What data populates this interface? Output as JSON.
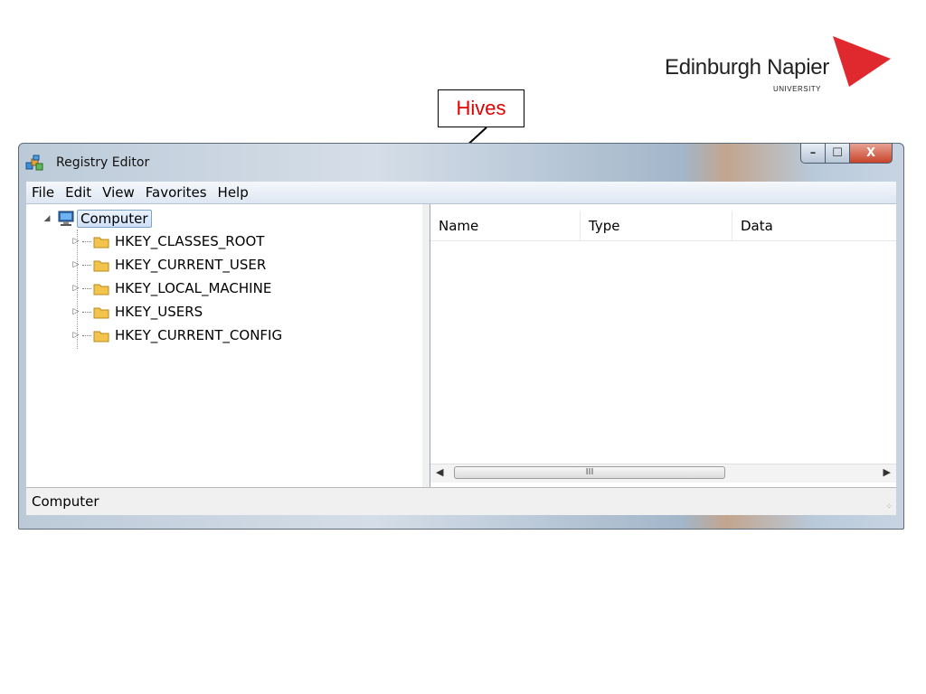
{
  "logo": {
    "name": "Edinburgh Napier",
    "sub": "UNIVERSITY",
    "accent": "#e0292f"
  },
  "callout": {
    "text": "Hives",
    "color": "#e00000"
  },
  "window": {
    "title": "Registry Editor",
    "buttons": {
      "minimize": "–",
      "maximize": "☐",
      "close": "X"
    }
  },
  "menu": [
    "File",
    "Edit",
    "View",
    "Favorites",
    "Help"
  ],
  "tree": {
    "root": "Computer",
    "hives": [
      "HKEY_CLASSES_ROOT",
      "HKEY_CURRENT_USER",
      "HKEY_LOCAL_MACHINE",
      "HKEY_USERS",
      "HKEY_CURRENT_CONFIG"
    ]
  },
  "list": {
    "columns": [
      "Name",
      "Type",
      "Data"
    ],
    "scroll_thumb": "III"
  },
  "status": "Computer"
}
